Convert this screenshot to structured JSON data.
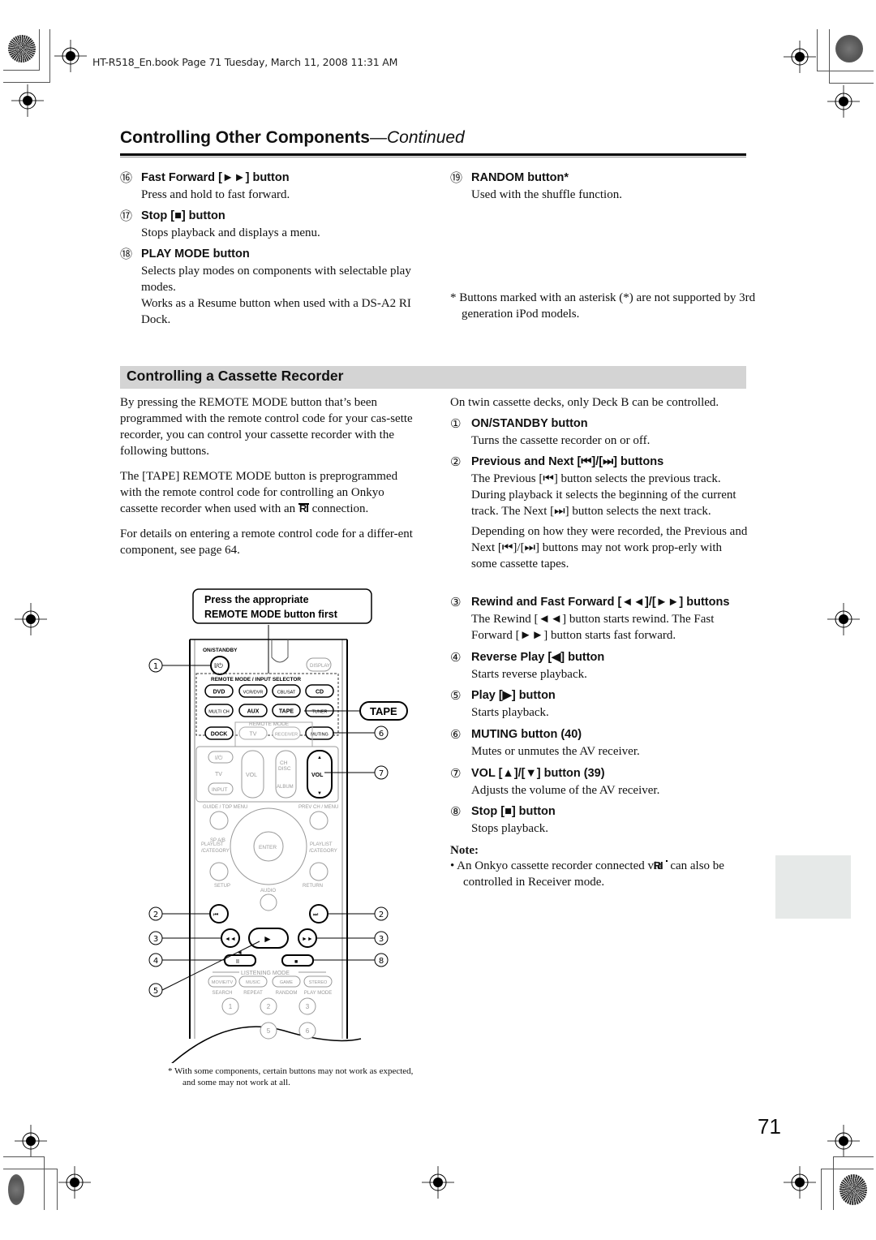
{
  "header_meta": "HT-R518_En.book  Page 71  Tuesday, March 11, 2008  11:31 AM",
  "page_title": {
    "main": "Controlling Other Components",
    "continued": "—Continued"
  },
  "top_left_items": [
    {
      "num": "⑯",
      "heading": "Fast Forward [►►] button",
      "desc": [
        "Press and hold to fast forward."
      ]
    },
    {
      "num": "⑰",
      "heading": "Stop [■] button",
      "desc": [
        "Stops playback and displays a menu."
      ]
    },
    {
      "num": "⑱",
      "heading": "PLAY MODE button",
      "desc": [
        "Selects play modes on components with selectable play modes.",
        "Works as a Resume button when used with a DS-A2 RI Dock."
      ]
    }
  ],
  "top_right_items": [
    {
      "num": "⑲",
      "heading": "RANDOM button*",
      "desc": [
        "Used with the shuffle function."
      ]
    }
  ],
  "asterisk_note": "*  Buttons marked with an asterisk (*) are not supported by 3rd generation iPod models.",
  "section": {
    "title": "Controlling a Cassette Recorder",
    "intro": [
      "By pressing the REMOTE MODE button that’s been programmed with the remote control code for your cas-sette recorder, you can control your cassette recorder with the following buttons.",
      "The [TAPE] REMOTE MODE button is preprogrammed with the remote control code for controlling an Onkyo cassette recorder when used with an",
      "connection.",
      "For details on entering a remote control code for a differ-ent component, see page 64."
    ],
    "ri_logo": "RI",
    "twin_deck_note": "On twin cassette decks, only Deck B can be controlled.",
    "items": [
      {
        "num": "①",
        "heading": "ON/STANDBY button",
        "desc": [
          "Turns the cassette recorder on or off."
        ]
      },
      {
        "num": "②",
        "heading": "Previous and Next [⏮]/[⏭] buttons",
        "desc": [
          "The Previous [⏮] button selects the previous track. During playback it selects the beginning of the current track. The Next [⏭] button selects the next track.",
          "Depending on how they were recorded, the Previous and Next [⏮]/[⏭] buttons may not work prop-erly with some cassette tapes."
        ]
      },
      {
        "num": "③",
        "heading": "Rewind and Fast Forward [◄◄]/[►►] buttons",
        "desc": [
          "The Rewind [◄◄] button starts rewind. The Fast Forward [►►] button starts fast forward."
        ]
      },
      {
        "num": "④",
        "heading": "Reverse Play [◀] button",
        "desc": [
          "Starts reverse playback."
        ]
      },
      {
        "num": "⑤",
        "heading": "Play [▶] button",
        "desc": [
          "Starts playback."
        ]
      },
      {
        "num": "⑥",
        "heading": "MUTING button (40)",
        "desc": [
          "Mutes or unmutes the AV receiver."
        ]
      },
      {
        "num": "⑦",
        "heading": "VOL [▲]/[▼] button (39)",
        "desc": [
          "Adjusts the volume of the AV receiver."
        ]
      },
      {
        "num": "⑧",
        "heading": "Stop [■] button",
        "desc": [
          "Stops playback."
        ]
      }
    ],
    "note_heading": "Note:",
    "note_bullet_a": "•  An Onkyo cassette recorder connected via",
    "note_bullet_b": "can also be controlled in Receiver mode."
  },
  "remote": {
    "callout_box": [
      "Press the appropriate",
      "REMOTE MODE button first"
    ],
    "tape_callout": "TAPE",
    "labels": {
      "on_standby": "ON/STANDBY",
      "display": "DISPLAY",
      "selector_group": "REMOTE MODE / INPUT SELECTOR",
      "remote_mode_group": "REMOTE MODE",
      "buttons_row1": [
        "DVD",
        "VCR/DVR",
        "CBL/SAT",
        "CD"
      ],
      "buttons_row2": [
        "MULTI CH",
        "AUX",
        "TAPE",
        "TUNER"
      ],
      "buttons_row3": [
        "DOCK",
        "TV",
        "RECEIVER",
        "MUTING"
      ],
      "tv": "TV",
      "input": "INPUT",
      "vol": "VOL",
      "ch_disc": [
        "CH",
        "DISC"
      ],
      "album": "ALBUM",
      "guide": "GUIDE / TOP MENU",
      "prev_ch": "PREV CH / MENU",
      "sp_ab": "SP A/B",
      "playlist": [
        "PLAYLIST",
        "/CATEGORY"
      ],
      "enter": "ENTER",
      "setup": "SETUP",
      "return": "RETURN",
      "audio": "AUDIO",
      "listening_mode": "LISTENING MODE",
      "mode_buttons": [
        "MOVIE/TV",
        "MUSIC",
        "GAME",
        "STEREO"
      ],
      "mode_sub": [
        "SEARCH",
        "REPEAT",
        "RANDOM",
        "PLAY MODE"
      ],
      "numbers": [
        "1",
        "2",
        "3",
        "5",
        "6"
      ]
    },
    "callouts": [
      "①",
      "②",
      "③",
      "④",
      "⑤",
      "⑥",
      "⑦",
      "⑧"
    ]
  },
  "diagram_footnote": "*   With some components, certain buttons may not work as expected, and some may not work at all.",
  "page_number": "71"
}
